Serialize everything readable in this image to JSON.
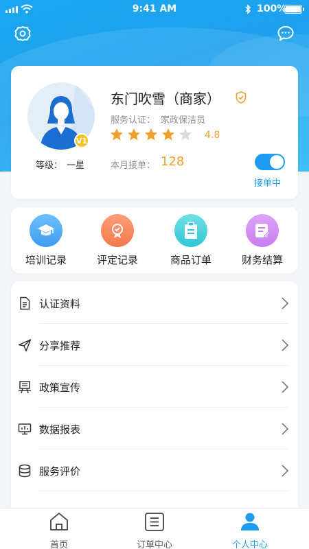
{
  "status_bar": {
    "time": "9:41 AM",
    "battery": "100%"
  },
  "profile": {
    "name": "东门吹雪（商家）",
    "cert_label": "服务认证：",
    "cert_value": "家政保洁员",
    "rating": "4.8",
    "stars_filled": 4,
    "stars_total": 5,
    "vip_badge": "V1",
    "level_label": "等级：",
    "level_value": "一星",
    "orders_label": "本月接单：",
    "orders_value": "128",
    "toggle_label": "接单中",
    "toggle_on": true
  },
  "quick_actions": [
    {
      "label": "培训记录",
      "icon": "graduation-cap-icon",
      "color": "#3f9df3"
    },
    {
      "label": "评定记录",
      "icon": "award-icon",
      "color": "#f4794b"
    },
    {
      "label": "商品订单",
      "icon": "clipboard-icon",
      "color": "#31c6d6"
    },
    {
      "label": "财务结算",
      "icon": "note-edit-icon",
      "color": "#c77df0"
    }
  ],
  "menu": [
    {
      "label": "认证资料",
      "icon": "document-icon"
    },
    {
      "label": "分享推荐",
      "icon": "paper-plane-icon"
    },
    {
      "label": "政策宣传",
      "icon": "billboard-icon"
    },
    {
      "label": "数据报表",
      "icon": "monitor-chart-icon"
    },
    {
      "label": "服务评价",
      "icon": "database-icon"
    }
  ],
  "tabs": [
    {
      "label": "首页",
      "icon": "home-icon"
    },
    {
      "label": "订单中心",
      "icon": "order-list-icon"
    },
    {
      "label": "个人中心",
      "icon": "user-icon",
      "active": true
    }
  ],
  "colors": {
    "primary": "#1f9cef",
    "accent": "#f2a02b"
  }
}
